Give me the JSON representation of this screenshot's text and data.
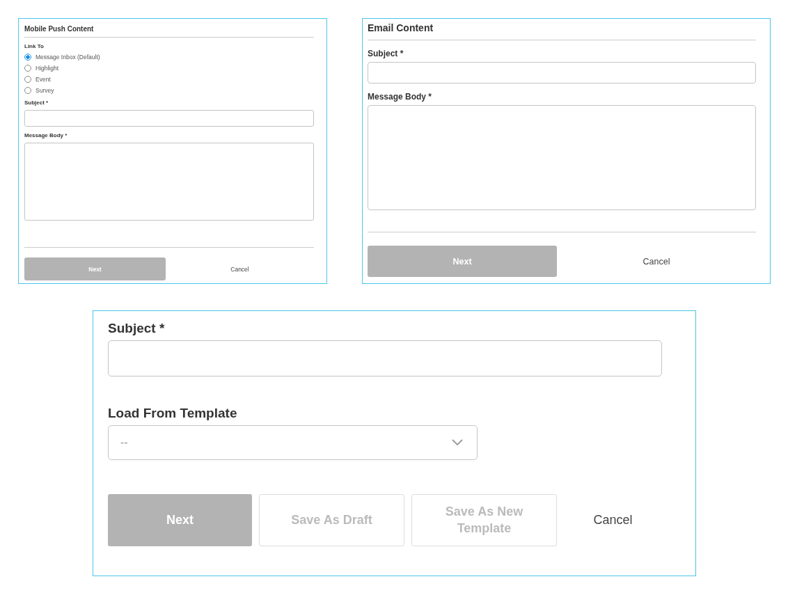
{
  "panels": [
    {
      "title": "Mobile Push Content",
      "footer_rule": true,
      "sections": [
        {
          "kind": "radio_group",
          "label": "Link To",
          "options": [
            {
              "label": "Message Inbox (Default)",
              "selected": true
            },
            {
              "label": "Highlight",
              "selected": false
            },
            {
              "label": "Event",
              "selected": false
            },
            {
              "label": "Survey",
              "selected": false
            }
          ]
        },
        {
          "kind": "text_field",
          "label": "Subject *"
        },
        {
          "kind": "text_area",
          "label": "Message Body *"
        }
      ],
      "buttons": [
        {
          "kind": "primary",
          "label": "Next",
          "disabled": true
        },
        {
          "kind": "text",
          "label": "Cancel",
          "disabled": false
        }
      ]
    },
    {
      "title": "Email Content",
      "footer_rule": true,
      "sections": [
        {
          "kind": "text_field",
          "label": "Subject *"
        },
        {
          "kind": "text_area",
          "label": "Message Body *"
        }
      ],
      "buttons": [
        {
          "kind": "primary",
          "label": "Next",
          "disabled": true
        },
        {
          "kind": "text",
          "label": "Cancel",
          "disabled": false
        }
      ]
    },
    {
      "footer_rule": false,
      "sections": [
        {
          "kind": "text_field",
          "label": "Subject *"
        },
        {
          "kind": "select",
          "label": "Load From Template",
          "value": "--"
        }
      ],
      "buttons": [
        {
          "kind": "primary",
          "label": "Next",
          "disabled": true
        },
        {
          "kind": "outline",
          "label": "Save As Draft",
          "disabled": true
        },
        {
          "kind": "outline",
          "label": "Save As New Template",
          "disabled": true
        },
        {
          "kind": "text",
          "label": "Cancel",
          "disabled": false
        }
      ]
    }
  ]
}
